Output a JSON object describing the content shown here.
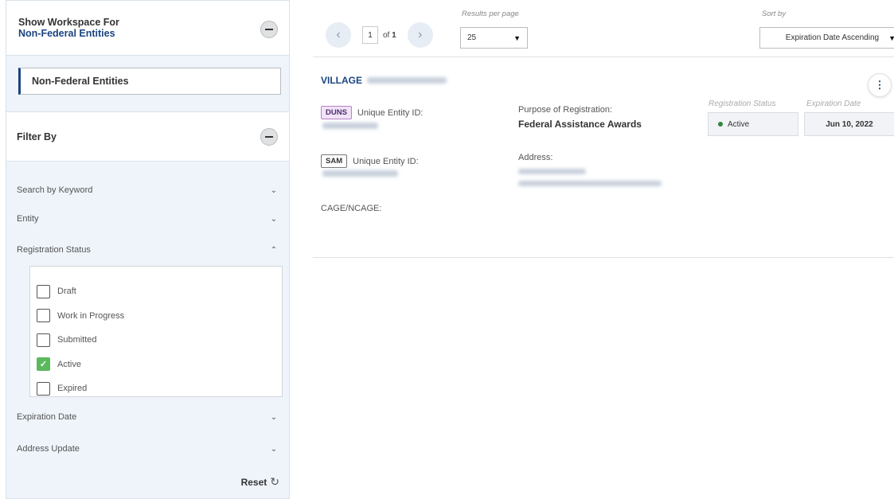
{
  "workspace": {
    "title": "Show Workspace For",
    "subtitle": "Non-Federal Entities",
    "selected": "Non-Federal Entities"
  },
  "filter": {
    "title": "Filter By",
    "facets": [
      {
        "label": "Search by Keyword",
        "expanded": false
      },
      {
        "label": "Entity",
        "expanded": false
      },
      {
        "label": "Registration Status",
        "expanded": true
      },
      {
        "label": "Expiration Date",
        "expanded": false
      },
      {
        "label": "Address Update",
        "expanded": false
      }
    ],
    "registration_status_options": [
      {
        "label": "Draft",
        "checked": false
      },
      {
        "label": "Work in Progress",
        "checked": false
      },
      {
        "label": "Submitted",
        "checked": false
      },
      {
        "label": "Active",
        "checked": true
      },
      {
        "label": "Expired",
        "checked": false
      }
    ],
    "reset_label": "Reset"
  },
  "pagination": {
    "current_page": "1",
    "of_text": "of",
    "total_pages": "1",
    "results_per_page_label": "Results per page",
    "results_per_page": "25",
    "sort_label": "Sort by",
    "sort_value": "Expiration Date Ascending"
  },
  "result": {
    "name": "VILLAGE",
    "duns_tag": "DUNS",
    "sam_tag": "SAM",
    "unique_entity_id_label": "Unique Entity ID:",
    "cage_label": "CAGE/NCAGE:",
    "purpose_label": "Purpose of Registration:",
    "purpose_value": "Federal Assistance Awards",
    "address_label": "Address:",
    "registration_status_label": "Registration Status",
    "registration_status_value": "Active",
    "expiration_date_label": "Expiration Date",
    "expiration_date_value": "Jun 10, 2022"
  },
  "colors": {
    "primary": "#1a4480",
    "sidebar_bg": "#eef4fa",
    "active_green": "#2e8540",
    "check_green": "#5cb85c",
    "duns_tag_bg": "#f1e3f8"
  }
}
